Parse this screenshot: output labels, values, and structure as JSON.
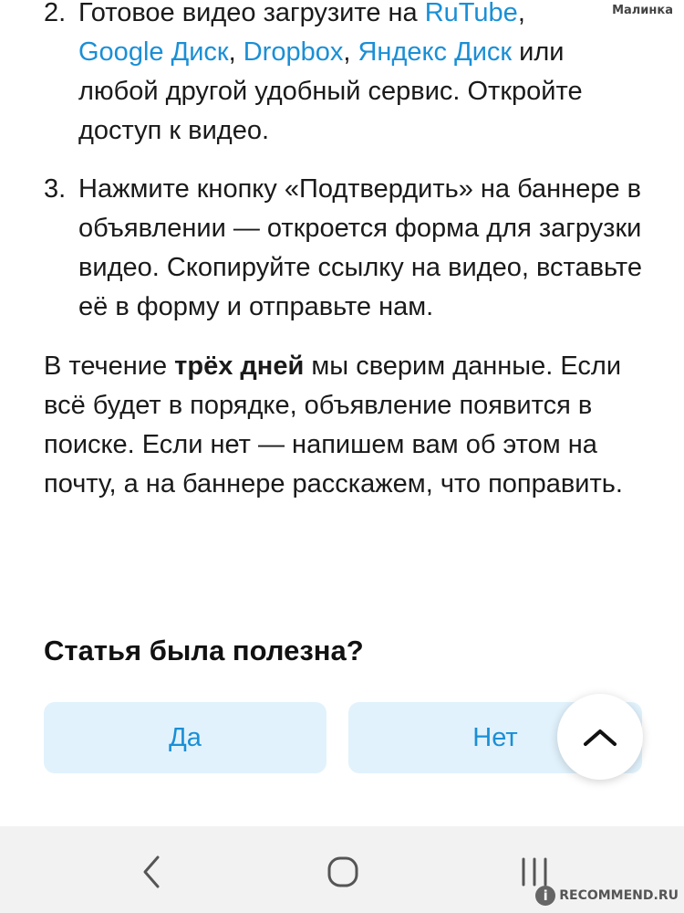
{
  "watermark_top": "Малинка",
  "article": {
    "step2": {
      "num": "2.",
      "t1": "Готовое видео загрузите на ",
      "link1": "RuTube",
      "t2": ",",
      "link2": "Google Диск",
      "t3": ", ",
      "link3": "Dropbox",
      "t4": ", ",
      "link4": "Яндекс Диск",
      "t5": " или любой другой удобный сервис. Откройте доступ к видео."
    },
    "step3": {
      "num": "3.",
      "text": "Нажмите кнопку «Подтвердить» на баннере в объявлении — откроется форма для загрузки видео. Скопируйте ссылку на видео, вставьте её в форму и отправьте нам."
    },
    "paragraph": {
      "t1": "В течение ",
      "bold": "трёх дней",
      "t2": " мы сверим данные. Если всё будет в порядке, объявление появится в поиске. Если нет — напишем вам об этом на почту, а на баннере расскажем, что поправить."
    }
  },
  "feedback": {
    "title": "Статья была полезна?",
    "yes_label": "Да",
    "no_label": "Нет"
  },
  "icons": {
    "scroll_top": "chevron-up-icon",
    "nav_back": "back-icon",
    "nav_home": "home-icon",
    "nav_recent": "recent-apps-icon"
  },
  "watermark_bottom": "RECOMMEND.RU",
  "colors": {
    "link": "#1a8fd6",
    "button_bg": "#e1f2fc",
    "navbar_bg": "#f2f2f2"
  }
}
